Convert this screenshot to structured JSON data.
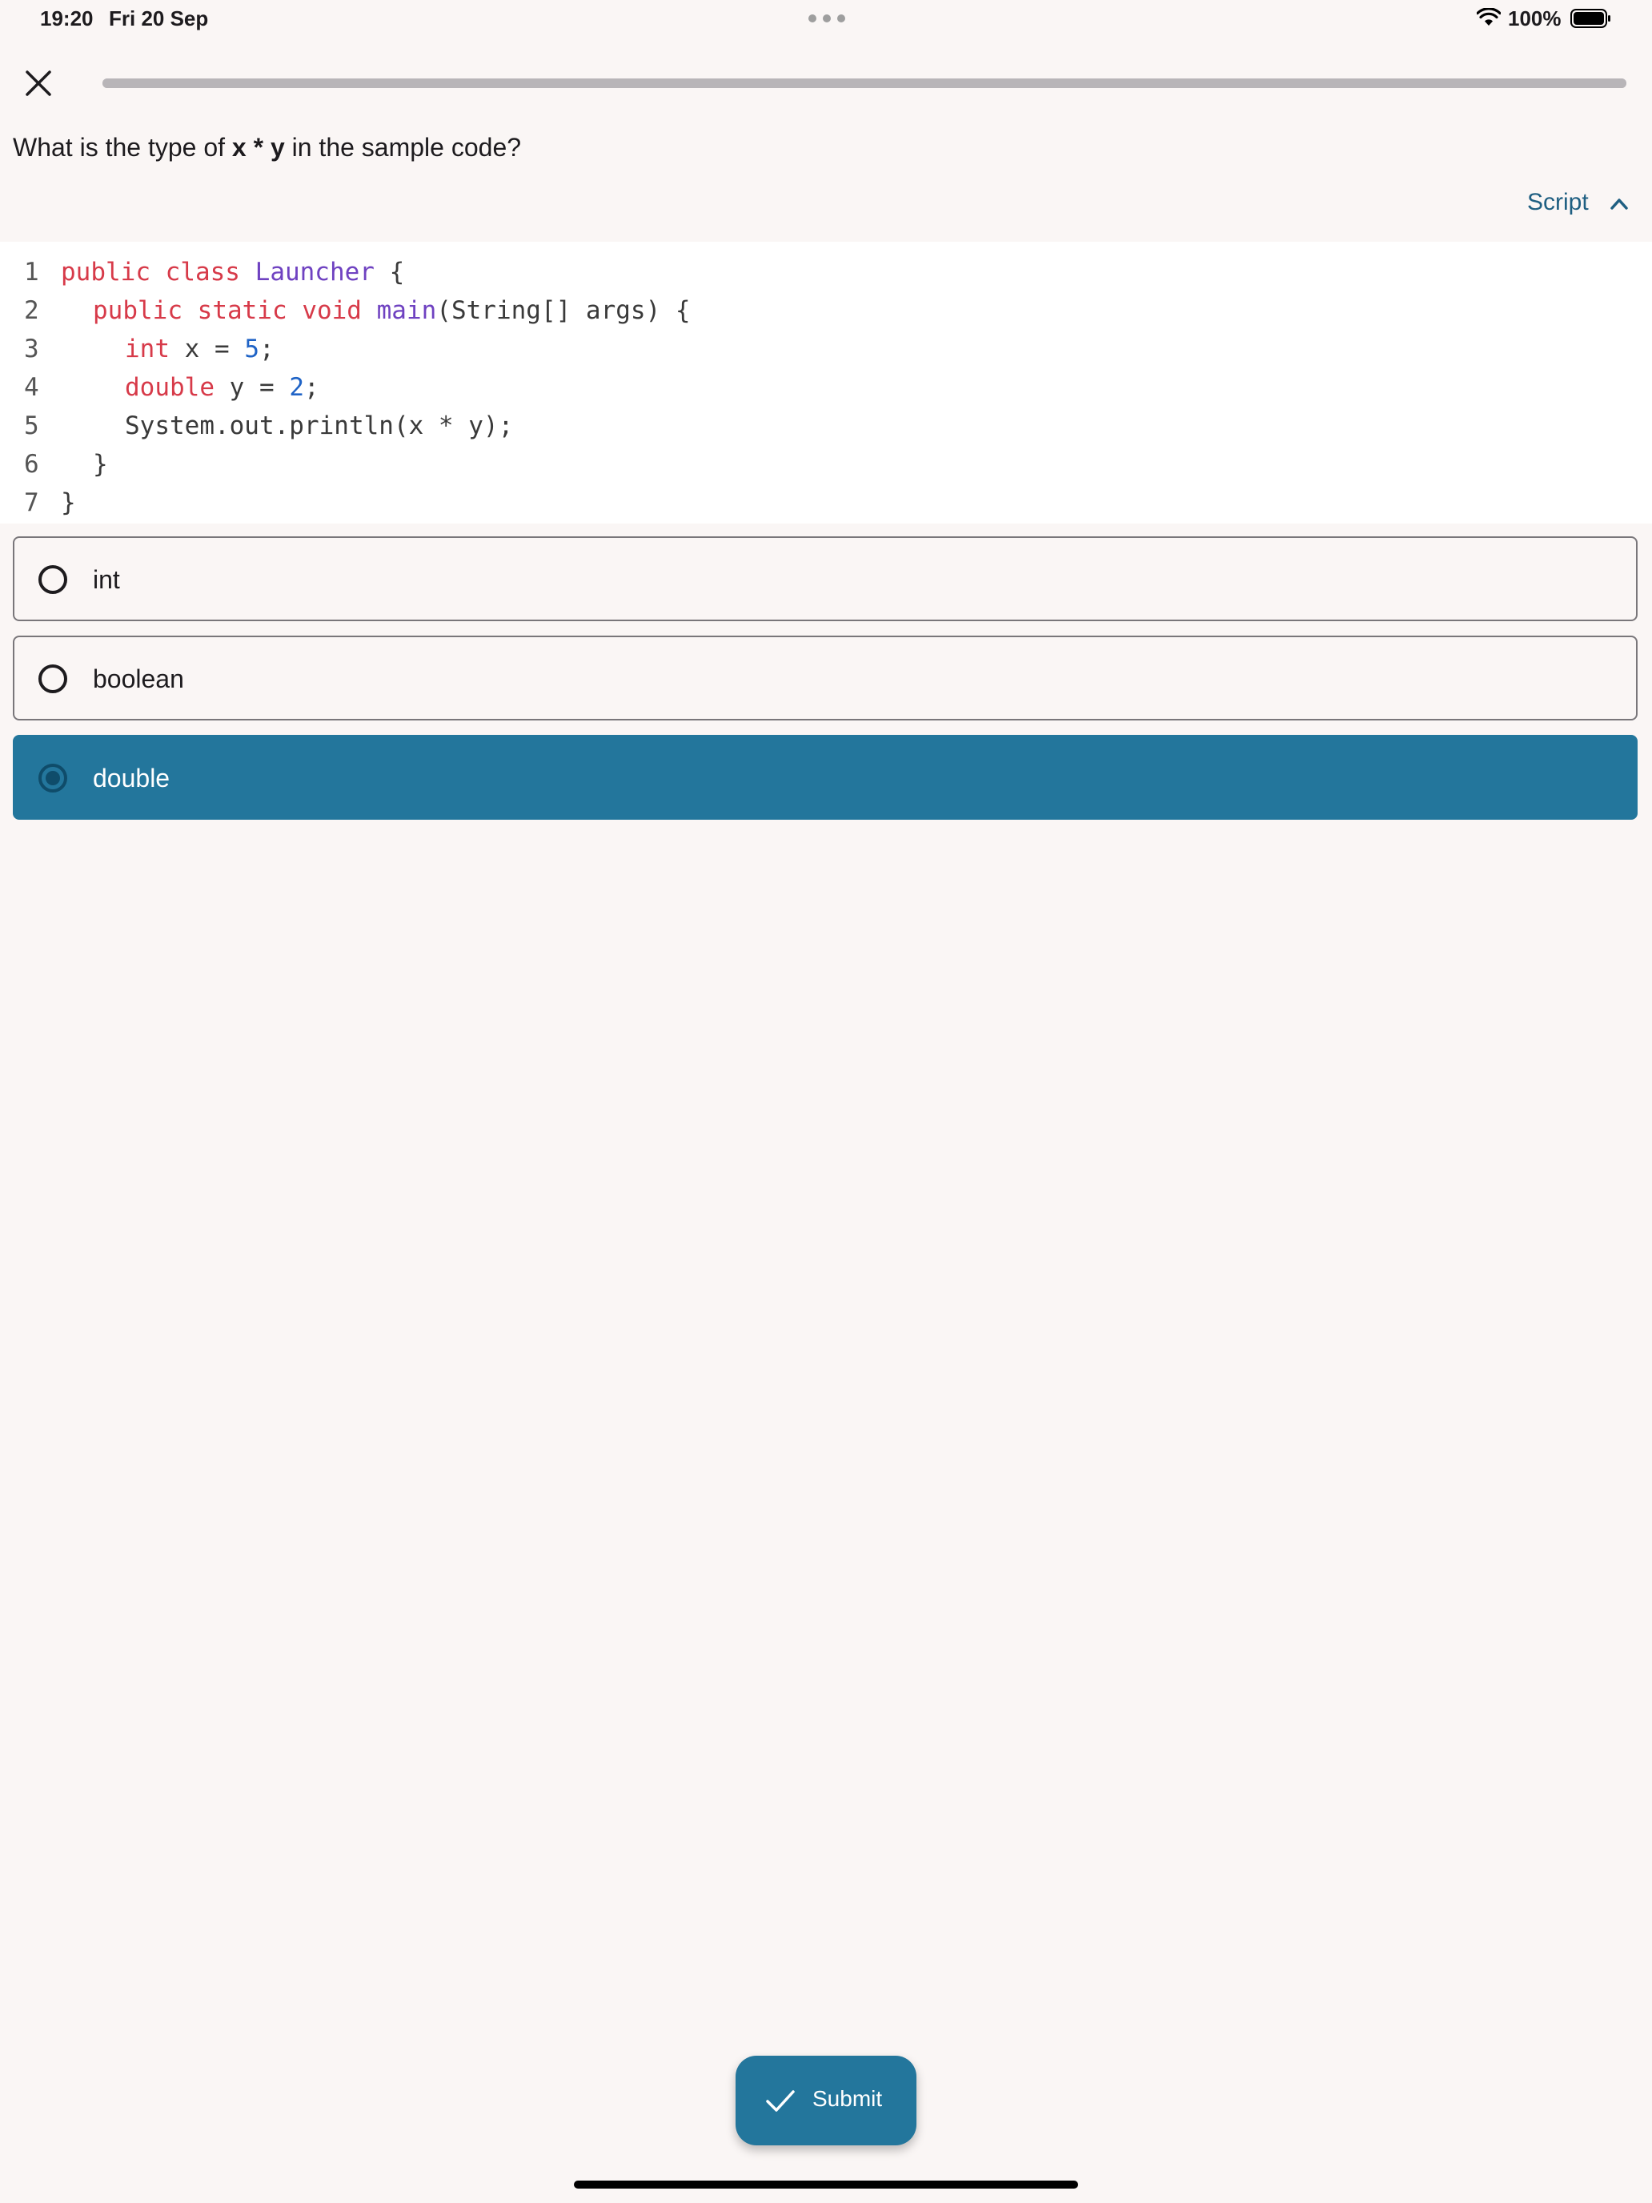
{
  "status_bar": {
    "time": "19:20",
    "date": "Fri 20 Sep",
    "battery": "100%"
  },
  "quiz": {
    "progress_fraction": 1.0,
    "question": {
      "prefix": "What is the type of ",
      "highlight": "x * y",
      "suffix": " in the sample code?"
    },
    "script_toggle_label": "Script",
    "code_lines": [
      {
        "num": "1",
        "indent": 0,
        "tokens": [
          {
            "t": "public",
            "c": "kw"
          },
          {
            "t": " "
          },
          {
            "t": "class",
            "c": "kw"
          },
          {
            "t": " "
          },
          {
            "t": "Launcher",
            "c": "fn"
          },
          {
            "t": " {"
          }
        ]
      },
      {
        "num": "2",
        "indent": 1,
        "tokens": [
          {
            "t": "public",
            "c": "kw"
          },
          {
            "t": " "
          },
          {
            "t": "static",
            "c": "kw"
          },
          {
            "t": " "
          },
          {
            "t": "void",
            "c": "kw"
          },
          {
            "t": " "
          },
          {
            "t": "main",
            "c": "fn"
          },
          {
            "t": "(String[] args) {"
          }
        ]
      },
      {
        "num": "3",
        "indent": 2,
        "tokens": [
          {
            "t": "int",
            "c": "kw"
          },
          {
            "t": " x = "
          },
          {
            "t": "5",
            "c": "num"
          },
          {
            "t": ";"
          }
        ]
      },
      {
        "num": "4",
        "indent": 2,
        "tokens": [
          {
            "t": "double",
            "c": "kw"
          },
          {
            "t": " y = "
          },
          {
            "t": "2",
            "c": "num"
          },
          {
            "t": ";"
          }
        ]
      },
      {
        "num": "5",
        "indent": 2,
        "tokens": [
          {
            "t": "System.out.println(x * y);"
          }
        ]
      },
      {
        "num": "6",
        "indent": 1,
        "tokens": [
          {
            "t": "}"
          }
        ]
      },
      {
        "num": "7",
        "indent": 0,
        "tokens": [
          {
            "t": "}"
          }
        ]
      }
    ],
    "options": [
      {
        "label": "int",
        "selected": false
      },
      {
        "label": "boolean",
        "selected": false
      },
      {
        "label": "double",
        "selected": true
      }
    ],
    "submit_label": "Submit"
  },
  "colors": {
    "accent": "#23769c",
    "keyword": "#d73a49",
    "function": "#6f42c1",
    "number": "#1f63c6"
  },
  "icons": [
    "close-icon",
    "chevron-up-icon",
    "check-icon",
    "wifi-icon",
    "battery-icon"
  ]
}
